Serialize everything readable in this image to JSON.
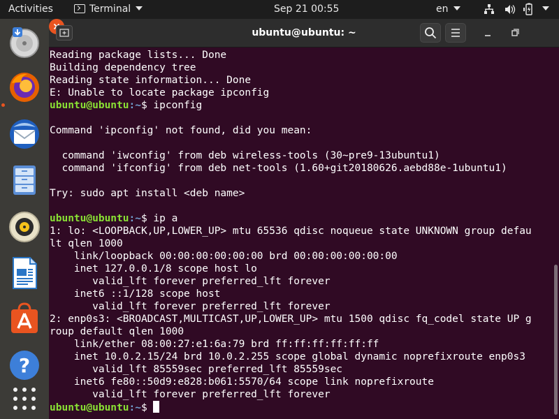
{
  "topbar": {
    "activities": "Activities",
    "app_name": "Terminal",
    "clock": "Sep 21  00:55",
    "language": "en",
    "icons": [
      "network-icon",
      "volume-icon",
      "battery-icon"
    ]
  },
  "dock": {
    "items": [
      "software-updater-icon",
      "firefox-icon",
      "thunderbird-icon",
      "files-icon",
      "rhythmbox-icon",
      "libreoffice-writer-icon",
      "ubuntu-software-icon",
      "help-icon",
      "show-applications-icon"
    ]
  },
  "window": {
    "title": "ubuntu@ubuntu: ~",
    "buttons": [
      "new-tab",
      "search",
      "menu",
      "minimize",
      "maximize",
      "close"
    ]
  },
  "terminal": {
    "prompt_user": "ubuntu@ubuntu",
    "prompt_path": ":~",
    "prompt_symbol": "$",
    "lines": [
      {
        "text": "Reading package lists... Done"
      },
      {
        "text": "Building dependency tree"
      },
      {
        "text": "Reading state information... Done"
      },
      {
        "text": "E: Unable to locate package ipconfig"
      },
      {
        "prompt": true,
        "text": " ipconfig"
      },
      {
        "text": ""
      },
      {
        "text": "Command 'ipconfig' not found, did you mean:"
      },
      {
        "text": ""
      },
      {
        "text": "  command 'iwconfig' from deb wireless-tools (30~pre9-13ubuntu1)"
      },
      {
        "text": "  command 'ifconfig' from deb net-tools (1.60+git20180626.aebd88e-1ubuntu1)"
      },
      {
        "text": ""
      },
      {
        "text": "Try: sudo apt install <deb name>"
      },
      {
        "text": ""
      },
      {
        "prompt": true,
        "text": " ip a"
      },
      {
        "text": "1: lo: <LOOPBACK,UP,LOWER_UP> mtu 65536 qdisc noqueue state UNKNOWN group defau"
      },
      {
        "text": "lt qlen 1000"
      },
      {
        "text": "    link/loopback 00:00:00:00:00:00 brd 00:00:00:00:00:00"
      },
      {
        "text": "    inet 127.0.0.1/8 scope host lo"
      },
      {
        "text": "       valid_lft forever preferred_lft forever"
      },
      {
        "text": "    inet6 ::1/128 scope host"
      },
      {
        "text": "       valid_lft forever preferred_lft forever"
      },
      {
        "text": "2: enp0s3: <BROADCAST,MULTICAST,UP,LOWER_UP> mtu 1500 qdisc fq_codel state UP g"
      },
      {
        "text": "roup default qlen 1000"
      },
      {
        "text": "    link/ether 08:00:27:e1:6a:79 brd ff:ff:ff:ff:ff:ff"
      },
      {
        "text": "    inet 10.0.2.15/24 brd 10.0.2.255 scope global dynamic noprefixroute enp0s3"
      },
      {
        "text": "       valid_lft 85559sec preferred_lft 85559sec"
      },
      {
        "text": "    inet6 fe80::50d9:e828:b061:5570/64 scope link noprefixroute"
      },
      {
        "text": "       valid_lft forever preferred_lft forever"
      },
      {
        "prompt": true,
        "text": " ",
        "cursor": true
      }
    ]
  },
  "colors": {
    "terminal_bg": "#300a24",
    "prompt_user": "#8ae234",
    "prompt_path": "#729fcf",
    "accent": "#e95420"
  }
}
